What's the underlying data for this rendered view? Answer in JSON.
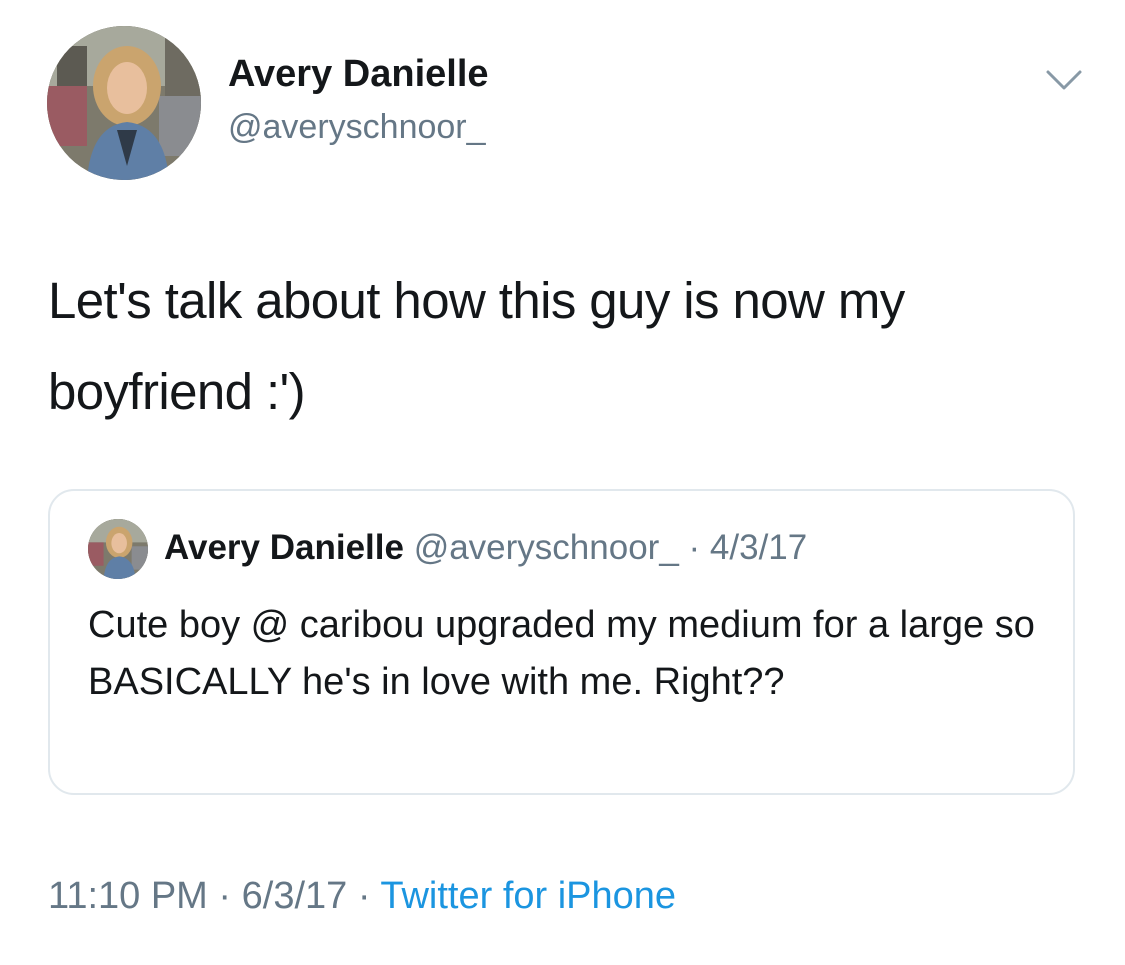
{
  "tweet": {
    "author": {
      "display_name": "Avery Danielle",
      "handle": "@averyschnoor_",
      "avatar_icon": "profile-photo"
    },
    "menu_icon": "chevron-down-icon",
    "text": "Let's talk about how this guy is now my boyfriend :')",
    "quoted_tweet": {
      "display_name": "Avery Danielle",
      "handle": "@averyschnoor_",
      "separator": "·",
      "date": "4/3/17",
      "text": "Cute boy @ caribou upgraded my medium for a large so BASICALLY he's in love with me. Right??"
    },
    "time": "11:10 PM",
    "separator": "·",
    "date": "6/3/17",
    "source": "Twitter for iPhone"
  },
  "colors": {
    "text_primary": "#14171a",
    "text_secondary": "#657786",
    "link": "#1b95e0",
    "border": "#e1e8ed"
  }
}
